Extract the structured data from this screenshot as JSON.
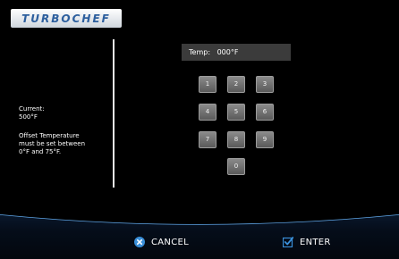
{
  "brand": {
    "logo_text": "TURBOCHEF"
  },
  "info": {
    "current_label": "Current:",
    "current_value": "500°F",
    "offset_line1": "Offset Temperature",
    "offset_line2": "must be set between",
    "offset_line3": "0°F and 75°F."
  },
  "display": {
    "label": "Temp:",
    "value": "000°F"
  },
  "keypad": {
    "keys": [
      "1",
      "2",
      "3",
      "4",
      "5",
      "6",
      "7",
      "8",
      "9",
      "0"
    ]
  },
  "actions": {
    "cancel_label": "CANCEL",
    "enter_label": "ENTER"
  },
  "colors": {
    "accent": "#3a8fd9",
    "background": "#000000"
  }
}
